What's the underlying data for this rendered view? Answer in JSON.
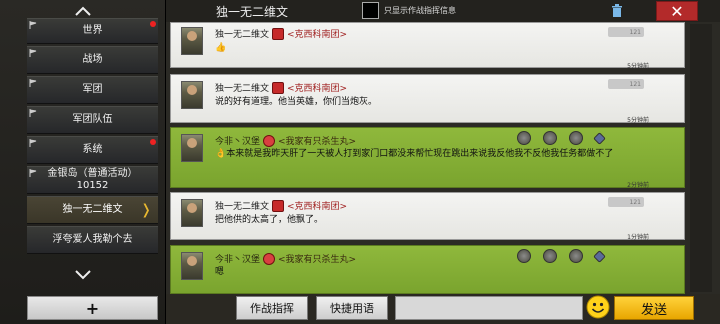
{
  "sidebar": {
    "items": [
      {
        "label": "世界",
        "dot": true
      },
      {
        "label": "战场",
        "dot": false
      },
      {
        "label": "军团",
        "dot": false
      },
      {
        "label": "军团队伍",
        "dot": false
      },
      {
        "label": "系统",
        "dot": true
      },
      {
        "label": "金银岛（普通活动）10152",
        "dot": false
      },
      {
        "label": "独一无二维文",
        "dot": false,
        "active": true
      },
      {
        "label": "浮夸爱人我勒个去",
        "dot": false
      }
    ],
    "add_label": "+"
  },
  "header": {
    "title": "独一无二维文",
    "only_cmd_label": "只显示作战指挥信息",
    "close_label": "✕"
  },
  "messages": [
    {
      "sender": "独一无二维文",
      "guild": "<克西科南团>",
      "text": "👍",
      "time": "5分钟前",
      "level": "121",
      "style": "white"
    },
    {
      "sender": "独一无二维文",
      "guild": "<克西科南团>",
      "text": "说的好有道理。他当英雄，你们当炮灰。",
      "time": "5分钟前",
      "level": "121",
      "style": "white"
    },
    {
      "sender": "今非丶汉堡",
      "guild": "<我家有只杀生丸>",
      "text": "👌本来就是我昨天肝了一天被人打到家门口都没来帮忙现在跳出来说我反他我不反他我任务都做不了",
      "time": "2分钟前",
      "style": "green"
    },
    {
      "sender": "独一无二维文",
      "guild": "<克西科南团>",
      "text": "把他供的太高了，他飘了。",
      "time": "1分钟前",
      "level": "121",
      "style": "white"
    },
    {
      "sender": "今非丶汉堡",
      "guild": "<我家有只杀生丸>",
      "text": "嗯",
      "time": "",
      "style": "green"
    }
  ],
  "bottom": {
    "cmd_label": "作战指挥",
    "quick_label": "快捷用语",
    "input_value": "",
    "send_label": "发送"
  },
  "colors": {
    "green_msg": "#8fb83c",
    "close_red": "#b32a2a",
    "send_yellow": "#ffd23a"
  }
}
